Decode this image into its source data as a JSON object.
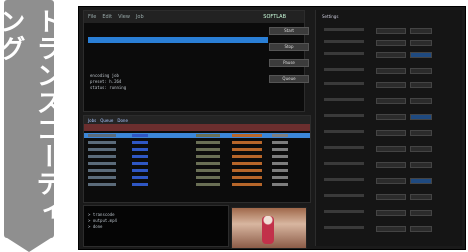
{
  "side_label": "トランスコーディング",
  "app": {
    "window_title": "SOFTLAB",
    "toolbar_items": [
      "File",
      "Edit",
      "View",
      "Job"
    ]
  },
  "console": {
    "log_lines": [
      "encoding job",
      "preset: h.264",
      "status: running"
    ]
  },
  "controls": [
    "Start",
    "Stop",
    "Pause",
    "Queue"
  ],
  "table": {
    "tabs": [
      "Jobs",
      "Queue",
      "Done"
    ]
  },
  "bottom_console": {
    "lines": [
      "> transcode",
      "> output.mp4",
      "> done"
    ]
  },
  "settings": {
    "header": "Settings"
  }
}
